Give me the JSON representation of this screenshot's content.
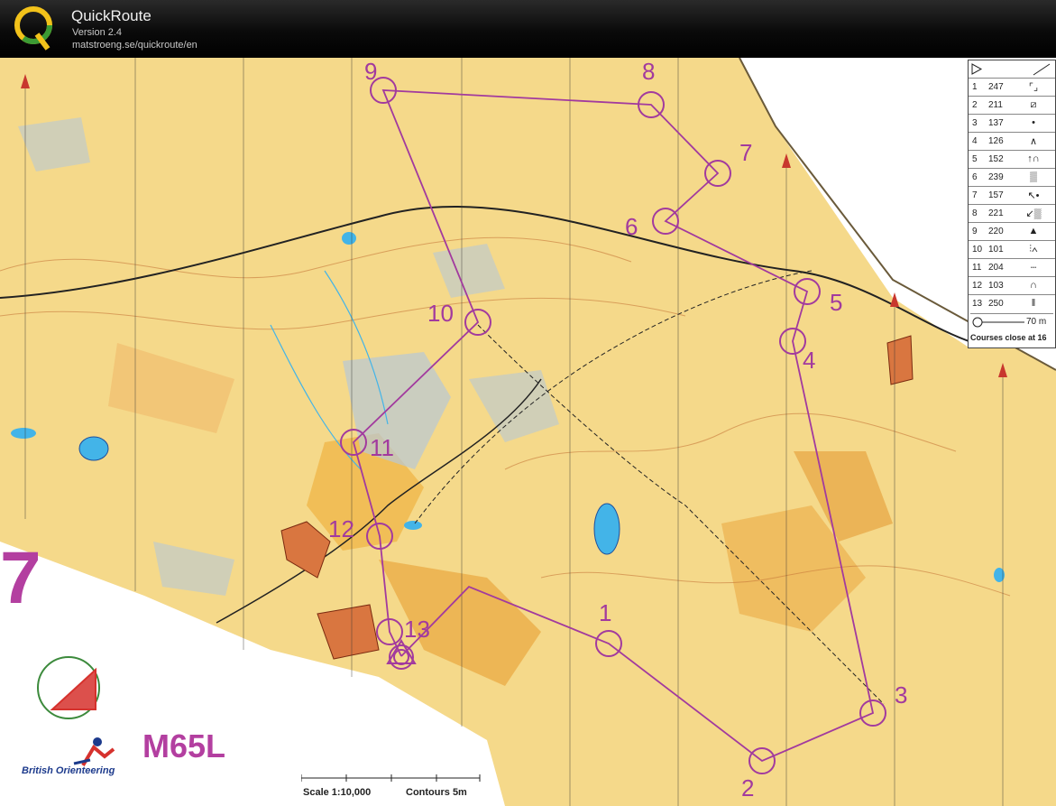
{
  "app": {
    "title": "QuickRoute",
    "version": "Version 2.4",
    "url": "matstroeng.se/quickroute/en"
  },
  "map": {
    "class_name": "M65L",
    "federation_label": "British Orienteering",
    "scale_text": "Scale 1:10,000",
    "contours_text": "Contours 5m",
    "partial_digit": "7",
    "controls": [
      {
        "label": "1"
      },
      {
        "label": "2"
      },
      {
        "label": "3"
      },
      {
        "label": "4"
      },
      {
        "label": "5"
      },
      {
        "label": "6"
      },
      {
        "label": "7"
      },
      {
        "label": "8"
      },
      {
        "label": "9"
      },
      {
        "label": "10"
      },
      {
        "label": "11"
      },
      {
        "label": "12"
      },
      {
        "label": "13"
      }
    ]
  },
  "legend": {
    "rows": [
      {
        "num": "1",
        "code": "247",
        "sym": "⌜⌟"
      },
      {
        "num": "2",
        "code": "211",
        "sym": "⧄"
      },
      {
        "num": "3",
        "code": "137",
        "sym": "•"
      },
      {
        "num": "4",
        "code": "126",
        "sym": "∧"
      },
      {
        "num": "5",
        "code": "152",
        "sym": "↑∩"
      },
      {
        "num": "6",
        "code": "239",
        "sym": "▒"
      },
      {
        "num": "7",
        "code": "157",
        "sym": "↖•"
      },
      {
        "num": "8",
        "code": "221",
        "sym": "↙▒"
      },
      {
        "num": "9",
        "code": "220",
        "sym": "▲"
      },
      {
        "num": "10",
        "code": "101",
        "sym": "⫶∧"
      },
      {
        "num": "11",
        "code": "204",
        "sym": "┄"
      },
      {
        "num": "12",
        "code": "103",
        "sym": "∩"
      },
      {
        "num": "13",
        "code": "250",
        "sym": "‖"
      }
    ],
    "scale_label": "70 m",
    "close_text": "Courses close at 16"
  },
  "colors": {
    "map_base": "#f5d98a",
    "open_land": "#f2c468",
    "rough_open": "#e9a846",
    "water": "#43b4e8",
    "marsh": "#b8c8d6",
    "course": "#a23a9e",
    "titlebar": "#000000"
  },
  "icons": {
    "logo": "quickroute-logo-icon",
    "north_arrow": "north-arrow-icon"
  }
}
